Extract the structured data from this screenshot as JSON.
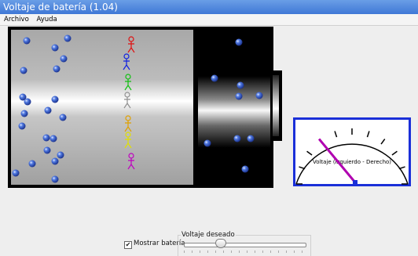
{
  "window": {
    "title": "Voltaje de batería (1.04)"
  },
  "menu": [
    "Archivo",
    "Ayuda"
  ],
  "meter": {
    "label": "Voltaje (Izquierdo - Derecho)",
    "needle_fraction": 0.28,
    "colors": {
      "border": "#1a2fd8",
      "needle": "#b000b0",
      "pivot": "#1a2fd8"
    }
  },
  "controls": {
    "show_battery_label": "Mostrar batería",
    "show_battery_checked": true,
    "voltage_label": "Voltaje deseado",
    "voltage_fraction": 0.3
  },
  "colors": {
    "title_bg": "#3f78d6",
    "figures": [
      "#e01010",
      "#1020e0",
      "#10c010",
      "#909090",
      "#e0a000",
      "#e0e000",
      "#c000c0"
    ],
    "ion": "#2e55c8"
  }
}
